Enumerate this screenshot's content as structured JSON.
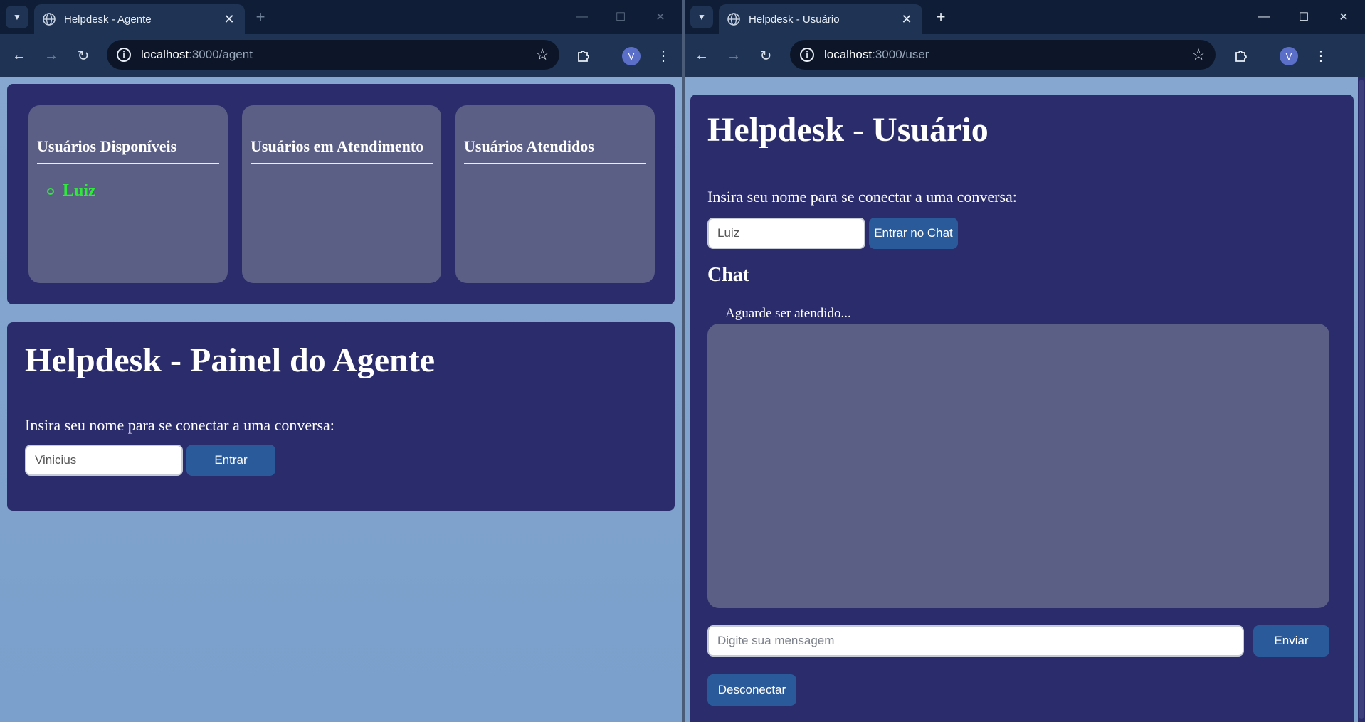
{
  "left_window": {
    "tab_title": "Helpdesk - Agente",
    "url_host": "localhost",
    "url_path": ":3000/agent",
    "avatar_letter": "V",
    "columns": [
      {
        "heading": "Usuários Disponíveis",
        "items": [
          "Luiz"
        ]
      },
      {
        "heading": "Usuários em Atendimento",
        "items": []
      },
      {
        "heading": "Usuários Atendidos",
        "items": []
      }
    ],
    "page_title": "Helpdesk - Painel do Agente",
    "prompt": "Insira seu nome para se conectar a uma conversa:",
    "name_value": "Vinicius",
    "enter_label": "Entrar"
  },
  "right_window": {
    "tab_title": "Helpdesk - Usuário",
    "url_host": "localhost",
    "url_path": ":3000/user",
    "avatar_letter": "V",
    "page_title": "Helpdesk - Usuário",
    "prompt": "Insira seu nome para se conectar a uma conversa:",
    "name_value": "Luiz",
    "join_label": "Entrar no Chat",
    "chat_heading": "Chat",
    "chat_status": "Aguarde ser atendido...",
    "message_placeholder": "Digite sua mensagem",
    "send_label": "Enviar",
    "disconnect_label": "Desconectar"
  },
  "icons": {
    "tab_list": "chevron-down-icon",
    "favicon": "globe-icon",
    "back": "arrow-left-icon",
    "forward": "arrow-right-icon",
    "reload": "reload-icon",
    "site_info": "info-icon",
    "bookmark": "star-icon",
    "extensions": "puzzle-icon",
    "menu": "kebab-icon"
  },
  "colors": {
    "page_bg": "#7fa3cc",
    "panel": "#2b2c6b",
    "card": "#5b5f86",
    "button": "#2a5a9a",
    "available_user": "#2ee83a"
  }
}
